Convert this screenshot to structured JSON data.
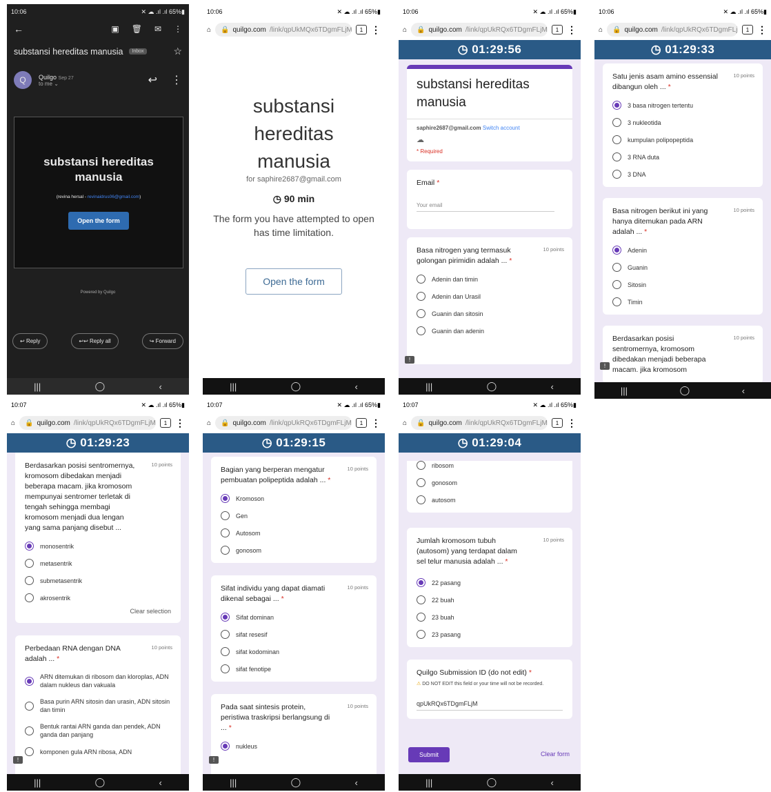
{
  "colors": {
    "accent": "#673ab7",
    "timer_bg": "#2a5a86",
    "form_bg": "#eee9f6",
    "link": "#4285f4",
    "required": "#d93025"
  },
  "status": {
    "t1": "10:06",
    "t2": "10:07",
    "right": "✕ ☁ .ıl .ıl 65%▮"
  },
  "url": {
    "host": "quilgo.com",
    "path1": "/link/qpUkMQx6TDgmFLjM",
    "path2": "/link/qpUkRQx6TDgmFLjM",
    "tabs": "1"
  },
  "nav": {
    "recents": "|||",
    "home": "◯",
    "back": "‹"
  },
  "s1": {
    "subject": "substansi hereditas manusia",
    "inbox_badge": "Inbox",
    "sender": "Quilgo",
    "date": "Sep 27",
    "to": "to me ⌄",
    "avatar": "Q",
    "email_title": "substansi hereditas manusia",
    "author_name": "(revina hersal - ",
    "author_email": "revinaidrus06@gmail.com",
    "author_end": ")",
    "open_btn": "Open the form",
    "powered": "Powered by Quilgo",
    "reply": "Reply",
    "reply_all": "Reply all",
    "forward": "Forward"
  },
  "s2": {
    "title": "substansi hereditas manusia",
    "for": "for saphire2687@gmail.com",
    "duration": "90 min",
    "message": "The form you have attempted to open has time limitation.",
    "open_btn": "Open the form"
  },
  "s3": {
    "timer": "01:29:56",
    "title": "substansi hereditas manusia",
    "account": "saphire2687@gmail.com",
    "switch": "Switch account",
    "required": "* Required",
    "email_label": "Email",
    "email_placeholder": "Your email",
    "q": "Basa nitrogen yang termasuk golongan pirimidin adalah ...",
    "pts": "10 points",
    "opts": [
      "Adenin dan timin",
      "Adenin dan Urasil",
      "Guanin dan sitosin",
      "Guanin dan adenin"
    ]
  },
  "s4": {
    "timer": "01:29:33",
    "q1": "Satu jenis asam amino essensial dibangun oleh ...",
    "q1_opts": [
      "3 basa nitrogen tertentu",
      "3 nukleotida",
      "kumpulan polipopeptida",
      "3 RNA duta",
      "3 DNA"
    ],
    "q2": "Basa nitrogen berikut ini yang hanya ditemukan pada ARN adalah ...",
    "q2_opts": [
      "Adenin",
      "Guanin",
      "Sitosin",
      "Timin"
    ],
    "q3": "Berdasarkan posisi sentromernya, kromosom dibedakan menjadi beberapa macam. jika kromosom",
    "pts": "10 points"
  },
  "s5": {
    "timer": "01:29:23",
    "q1": "Berdasarkan posisi sentromernya, kromosom dibedakan menjadi beberapa macam. jika kromosom mempunyai sentromer terletak di tengah sehingga membagi kromosom menjadi dua lengan yang sama panjang disebut ...",
    "q1_opts": [
      "monosentrik",
      "metasentrik",
      "submetasentrik",
      "akrosentrik"
    ],
    "clear": "Clear selection",
    "q2": "Perbedaan RNA dengan DNA adalah ...",
    "q2_opts": [
      "ARN ditemukan di ribosom dan kloroplas, ADN dalam nukleus dan vakuala",
      "Basa purin ARN sitosin dan urasin, ADN sitosin dan timin",
      "Bentuk rantai ARN ganda dan pendek, ADN ganda dan panjang",
      "komponen gula ARN ribosa, ADN"
    ],
    "pts": "10 points"
  },
  "s6": {
    "timer": "01:29:15",
    "q1": "Bagian yang berperan mengatur pembuatan polipeptida adalah ...",
    "q1_opts": [
      "Kromoson",
      "Gen",
      "Autosom",
      "gonosom"
    ],
    "q2": "Sifat individu yang dapat diamati dikenal sebagai ...",
    "q2_opts": [
      "Sifat dominan",
      "sifat resesif",
      "sifat kodominan",
      "sifat fenotipe"
    ],
    "q3": "Pada saat sintesis protein, peristiwa traskripsi berlangsung di ...",
    "q3_opts": [
      "nukleus"
    ],
    "pts": "10 points"
  },
  "s7": {
    "timer": "01:29:04",
    "prev_opts": [
      "ribosom",
      "gonosom",
      "autosom"
    ],
    "q1": "Jumlah kromosom tubuh (autosom) yang terdapat dalam sel telur manusia adalah ...",
    "q1_opts": [
      "22 pasang",
      "22 buah",
      "23 buah",
      "23 pasang"
    ],
    "sub_label": "Quilgo Submission ID (do not edit)",
    "sub_warn": "DO NOT EDIT this field or your time will not be recorded.",
    "sub_value": "qpUkRQx6TDgmFLjM",
    "submit": "Submit",
    "clear_form": "Clear form",
    "pts": "10 points"
  }
}
